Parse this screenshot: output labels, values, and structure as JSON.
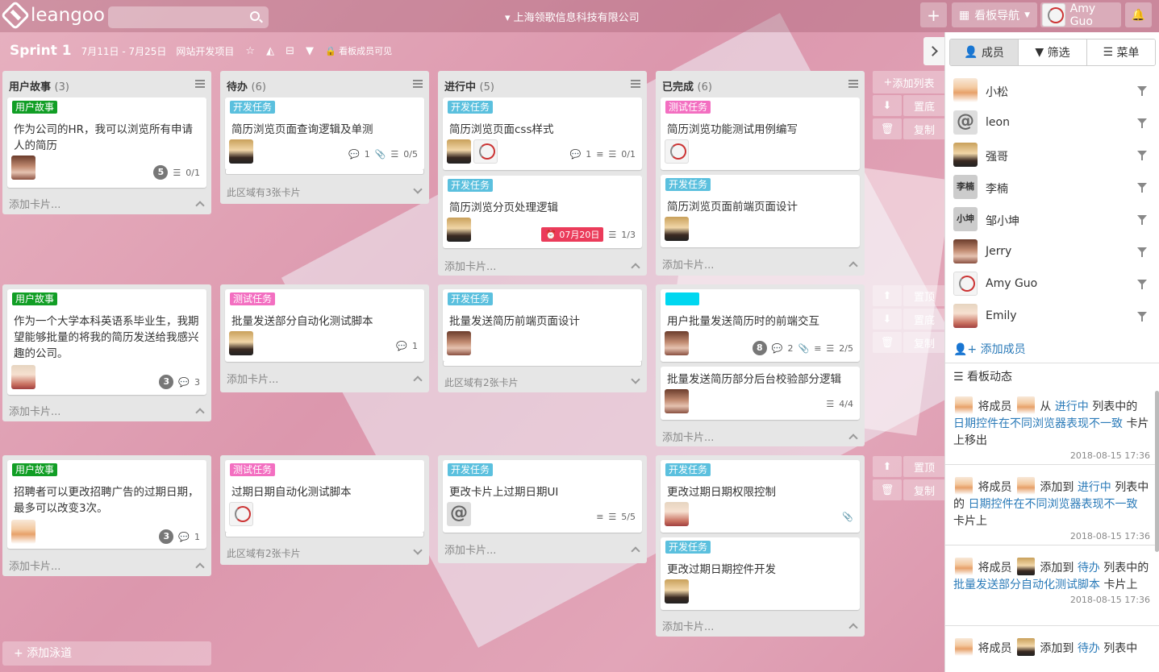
{
  "app": {
    "logo_text": "leangoo",
    "company": "上海领歌信息科技有限公司",
    "search_placeholder": ""
  },
  "topbar": {
    "add": "+",
    "board_nav": "看板导航",
    "user": "Amy Guo",
    "bell": "🔔"
  },
  "board": {
    "title": "Sprint 1",
    "dates": "7月11日 - 7月25日",
    "project": "网站开发项目",
    "visibility": "看板成员可见"
  },
  "lanes": [
    {
      "lists": [
        {
          "title": "用户故事",
          "count": "(3)",
          "cards": [
            {
              "tag": "用户故事",
              "tag_color": "#119e25",
              "text": "作为公司的HR，我可以浏览所有申请人的简历",
              "badge": "5",
              "checklist": "0/1"
            }
          ],
          "add": "添加卡片..."
        },
        {
          "title": "待办",
          "count": "(6)",
          "cards": [
            {
              "tag": "开发任务",
              "tag_color": "#5bc0de",
              "text": "简历浏览页面查询逻辑及单测",
              "comments": "1",
              "checklist": "0/5"
            }
          ],
          "more": "此区域有3张卡片"
        },
        {
          "title": "进行中",
          "count": "(5)",
          "cards": [
            {
              "tag": "开发任务",
              "tag_color": "#5bc0de",
              "text": "简历浏览页面css样式",
              "comments": "1",
              "checklist": "0/1"
            },
            {
              "tag": "开发任务",
              "tag_color": "#5bc0de",
              "text": "简历浏览分页处理逻辑",
              "due": "07月20日",
              "checklist": "1/3"
            }
          ],
          "add": "添加卡片..."
        },
        {
          "title": "已完成",
          "count": "(6)",
          "cards": [
            {
              "tag": "测试任务",
              "tag_color": "#f36fc1",
              "text": "简历浏览功能测试用例编写"
            },
            {
              "tag": "开发任务",
              "tag_color": "#5bc0de",
              "text": "简历浏览页面前端页面设计"
            }
          ],
          "add": "添加卡片..."
        }
      ]
    },
    {
      "lists": [
        {
          "cards": [
            {
              "tag": "用户故事",
              "tag_color": "#119e25",
              "text": "作为一个大学本科英语系毕业生，我期望能够批量的将我的简历发送给我感兴趣的公司。",
              "badge": "3",
              "comments": "3"
            }
          ],
          "add": "添加卡片..."
        },
        {
          "cards": [
            {
              "tag": "测试任务",
              "tag_color": "#f36fc1",
              "text": "批量发送部分自动化测试脚本",
              "comments": "1"
            }
          ],
          "add": "添加卡片..."
        },
        {
          "cards": [
            {
              "tag": "开发任务",
              "tag_color": "#5bc0de",
              "text": "批量发送简历前端页面设计"
            }
          ],
          "more": "此区域有2张卡片"
        },
        {
          "cards": [
            {
              "tag": "",
              "tag_color": "#00d7f0",
              "text": "用户批量发送简历时的前端交互",
              "badge": "8",
              "comments": "2",
              "checklist": "2/5"
            },
            {
              "text": "批量发送简历部分后台校验部分逻辑",
              "checklist": "4/4"
            }
          ],
          "add": "添加卡片..."
        }
      ]
    },
    {
      "lists": [
        {
          "cards": [
            {
              "tag": "用户故事",
              "tag_color": "#119e25",
              "text": "招聘者可以更改招聘广告的过期日期，最多可以改变3次。",
              "badge": "3",
              "comments": "1"
            }
          ],
          "add": "添加卡片..."
        },
        {
          "cards": [
            {
              "tag": "测试任务",
              "tag_color": "#f36fc1",
              "text": "过期日期自动化测试脚本"
            }
          ],
          "more": "此区域有2张卡片"
        },
        {
          "cards": [
            {
              "tag": "开发任务",
              "tag_color": "#5bc0de",
              "text": "更改卡片上过期日期UI",
              "checklist": "5/5"
            }
          ],
          "add": "添加卡片..."
        },
        {
          "cards": [
            {
              "tag": "开发任务",
              "tag_color": "#5bc0de",
              "text": "更改过期日期权限控制"
            },
            {
              "tag": "开发任务",
              "tag_color": "#5bc0de",
              "text": "更改过期日期控件开发"
            }
          ],
          "add": "添加卡片..."
        }
      ]
    }
  ],
  "ops": {
    "add_list": "添加列表",
    "to_bottom": "置底",
    "copy": "复制",
    "to_top": "置顶"
  },
  "add_swimlane": "添加泳道",
  "sidebar": {
    "tabs": [
      "成员",
      "筛选",
      "菜单"
    ],
    "members": [
      "小松",
      "leon",
      "强哥",
      "李楠",
      "邹小坤",
      "Jerry",
      "Amy Guo",
      "Emily"
    ],
    "member_short": [
      "李楠",
      "小坤"
    ],
    "add_member": "添加成员",
    "activity_title": "看板动态",
    "activities": [
      {
        "pre": "将成员",
        "verb": "从",
        "list": "进行中",
        "mid": "列表中的",
        "card": "日期控件在不同浏览器表现不一致",
        "post": "卡片上移出",
        "time": "2018-08-15 17:36"
      },
      {
        "pre": "将成员",
        "verb": "添加到",
        "list": "进行中",
        "mid": "列表中的",
        "card": "日期控件在不同浏览器表现不一致",
        "post": "卡片上",
        "time": "2018-08-15 17:36"
      },
      {
        "pre": "将成员",
        "verb": "添加到",
        "list": "待办",
        "mid": "列表中的",
        "card": "批量发送部分自动化测试脚本",
        "post": "卡片上",
        "time": "2018-08-15 17:36"
      },
      {
        "pre": "将成员",
        "verb": "添加到",
        "list": "待办",
        "mid": "列表中",
        "card": "",
        "post": "",
        "time": ""
      }
    ]
  },
  "colors": {
    "link": "#2a7ab8",
    "due": "#eb3b5a"
  }
}
